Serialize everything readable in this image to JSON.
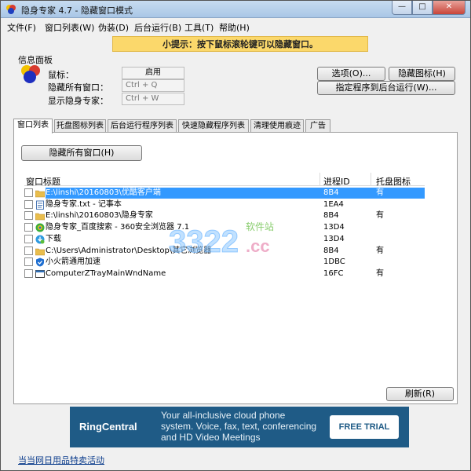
{
  "window": {
    "title": "隐身专家 4.7 - 隐藏窗口模式",
    "min_symbol": "—",
    "max_symbol": "□",
    "close_symbol": "✕"
  },
  "menu": [
    "文件(F)",
    "窗口列表(W)",
    "伪装(D)",
    "后台运行(B)",
    "工具(T)",
    "帮助(H)"
  ],
  "hint": "小提示：按下鼠标滚轮键可以隐藏窗口。",
  "info_panel": {
    "label": "信息面板",
    "mouse_label": "鼠标：",
    "mouse_value": "启用",
    "hide_all_label": "隐藏所有窗口：",
    "hide_all_value": "Ctrl + Q",
    "show_label": "显示隐身专家：",
    "show_value": "Ctrl + W"
  },
  "buttons": {
    "options": "选项(O)...",
    "hide_icon": "隐藏图标(H)",
    "run_background": "指定程序到后台运行(W)...",
    "hide_all_windows": "隐藏所有窗口(H)",
    "refresh": "刷新(R)"
  },
  "tabs": [
    "窗口列表",
    "托盘图标列表",
    "后台运行程序列表",
    "快速隐藏程序列表",
    "清理使用痕迹",
    "广告"
  ],
  "grid": {
    "headers": {
      "title": "窗口标题",
      "pid": "进程ID",
      "tray": "托盘图标"
    },
    "rows": [
      {
        "title": "E:\\linshi\\20160803\\优酷客户端",
        "pid": "8B4",
        "tray": "有",
        "icon": "folder-icon",
        "selected": true
      },
      {
        "title": "隐身专家.txt - 记事本",
        "pid": "1EA4",
        "tray": "",
        "icon": "notepad-icon"
      },
      {
        "title": "E:\\linshi\\20160803\\隐身专家",
        "pid": "8B4",
        "tray": "有",
        "icon": "folder-icon"
      },
      {
        "title": "隐身专家_百度搜索 - 360安全浏览器 7.1",
        "pid": "13D4",
        "tray": "",
        "icon": "browser-icon"
      },
      {
        "title": "下载",
        "pid": "13D4",
        "tray": "",
        "icon": "download-icon"
      },
      {
        "title": "C:\\Users\\Administrator\\Desktop\\其它浏览器",
        "pid": "8B4",
        "tray": "有",
        "icon": "folder-icon"
      },
      {
        "title": "小火箭通用加速",
        "pid": "1DBC",
        "tray": "",
        "icon": "shield-icon"
      },
      {
        "title": "ComputerZTrayMainWndName",
        "pid": "16FC",
        "tray": "有",
        "icon": "window-icon"
      }
    ]
  },
  "watermark": {
    "number": "3322",
    "label": "软件站",
    "suffix": ".cc"
  },
  "ad": {
    "logo": "RingCentral",
    "text": "Your all-inclusive cloud phone system. Voice, fax, text, conferencing and HD Video Meetings",
    "cta": "FREE TRIAL"
  },
  "status_link": "当当网日用品特卖活动",
  "colors": {
    "accent": "#3399ff",
    "hint_bg": "#fbd86b",
    "ad_bg": "#1f5b86"
  }
}
